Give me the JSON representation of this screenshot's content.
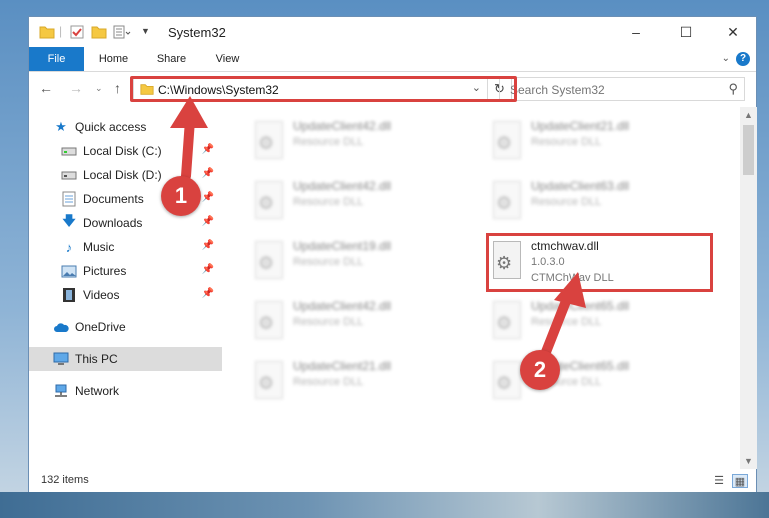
{
  "window": {
    "title": "System32",
    "controls": {
      "minimize": "–",
      "maximize": "☐",
      "close": "✕"
    }
  },
  "ribbon": {
    "tabs": [
      {
        "label": "File"
      },
      {
        "label": "Home"
      },
      {
        "label": "Share"
      },
      {
        "label": "View"
      }
    ],
    "help": "?"
  },
  "nav": {
    "address": "C:\\Windows\\System32",
    "search_placeholder": "Search System32"
  },
  "sidebar": {
    "items": [
      {
        "label": "Quick access",
        "icon": "star-icon"
      },
      {
        "label": "Local Disk (C:)",
        "icon": "drive-icon"
      },
      {
        "label": "Local Disk (D:)",
        "icon": "drive-icon"
      },
      {
        "label": "Documents",
        "icon": "documents-icon"
      },
      {
        "label": "Downloads",
        "icon": "download-icon"
      },
      {
        "label": "Music",
        "icon": "music-icon"
      },
      {
        "label": "Pictures",
        "icon": "pictures-icon"
      },
      {
        "label": "Videos",
        "icon": "videos-icon"
      },
      {
        "label": "OneDrive",
        "icon": "cloud-icon"
      },
      {
        "label": "This PC",
        "icon": "computer-icon"
      },
      {
        "label": "Network",
        "icon": "network-icon"
      }
    ]
  },
  "files": [
    {
      "name": "UpdateClient42.dll",
      "type": "Resource DLL"
    },
    {
      "name": "UpdateClient21.dll",
      "type": "Resource DLL"
    },
    {
      "name": "UpdateClient42.dll",
      "type": "Resource DLL"
    },
    {
      "name": "UpdateClient63.dll",
      "type": "Resource DLL"
    },
    {
      "name": "UpdateClient19.dll",
      "type": "Resource DLL"
    },
    {
      "name": "ctmchwav.dll",
      "version": "1.0.3.0",
      "type": "CTMChWav DLL"
    },
    {
      "name": "UpdateClient42.dll",
      "type": "Resource DLL"
    },
    {
      "name": "UpdateClient65.dll",
      "type": "Resource DLL"
    },
    {
      "name": "UpdateClient21.dll",
      "type": "Resource DLL"
    },
    {
      "name": "UpdateClient65.dll",
      "type": "Resource DLL"
    }
  ],
  "status": {
    "item_count": "132 items"
  },
  "annotations": {
    "step1": "1",
    "step2": "2",
    "accent": "#d9423f"
  }
}
